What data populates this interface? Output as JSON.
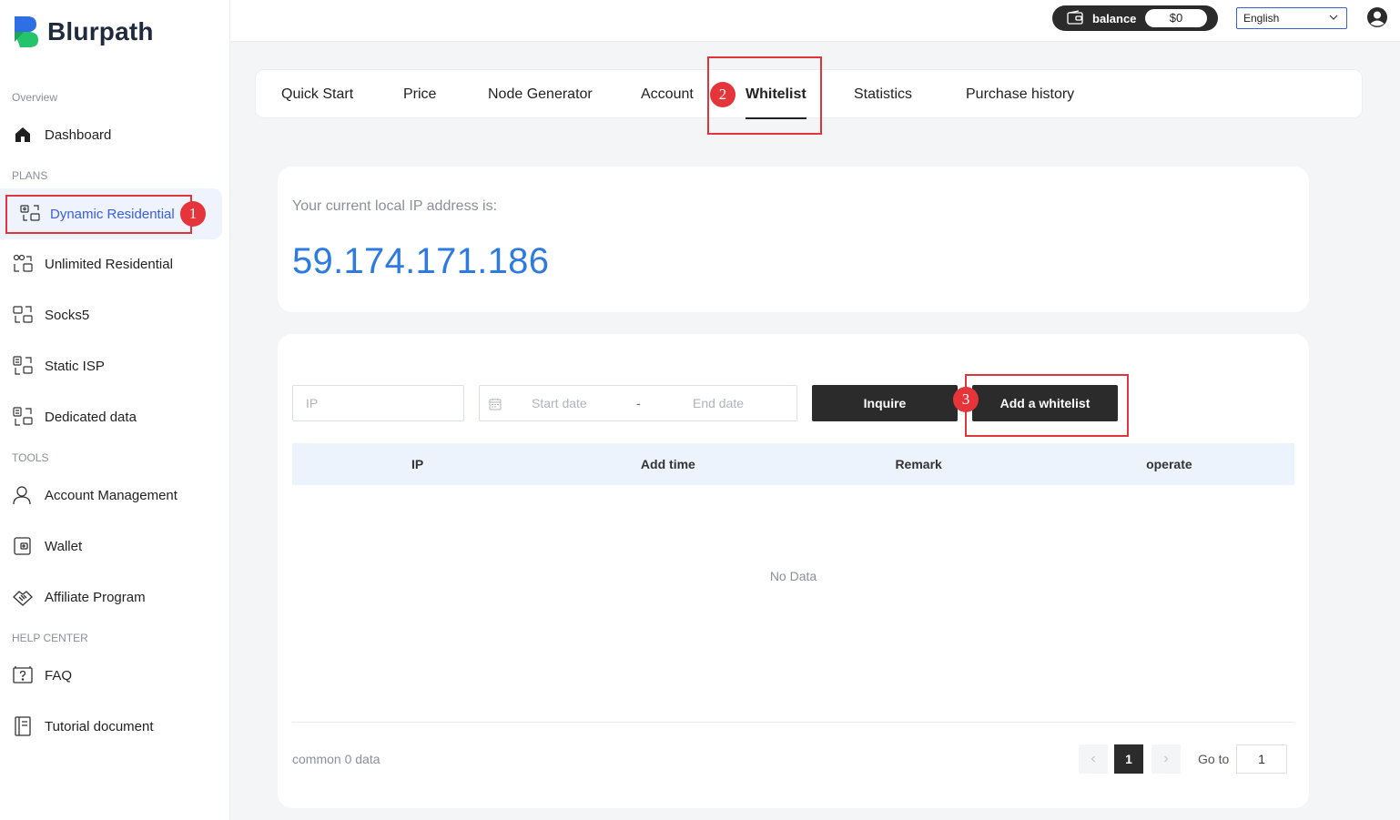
{
  "brand": {
    "name": "Blurpath"
  },
  "sidebar": {
    "sections": {
      "overview": "Overview",
      "plans": "PLANS",
      "tools": "TOOLS",
      "help": "HELP CENTER"
    },
    "items": {
      "dashboard": "Dashboard",
      "dynamic_residential": "Dynamic Residential",
      "unlimited_residential": "Unlimited Residential",
      "socks5": "Socks5",
      "static_isp": "Static ISP",
      "dedicated_data": "Dedicated data",
      "account_management": "Account Management",
      "wallet": "Wallet",
      "affiliate_program": "Affiliate Program",
      "faq": "FAQ",
      "tutorial_document": "Tutorial document"
    }
  },
  "header": {
    "balance_label": "balance",
    "balance_value": "$0",
    "language": "English"
  },
  "tabs": {
    "quick_start": "Quick Start",
    "price": "Price",
    "node_generator": "Node Generator",
    "account": "Account",
    "whitelist": "Whitelist",
    "statistics": "Statistics",
    "purchase_history": "Purchase history"
  },
  "ip_card": {
    "label": "Your current local IP address is:",
    "ip": "59.174.171.186"
  },
  "filters": {
    "ip_placeholder": "IP",
    "start_date_placeholder": "Start date",
    "date_separator": "-",
    "end_date_placeholder": "End date",
    "inquire_label": "Inquire",
    "add_whitelist_label": "Add a whitelist"
  },
  "table": {
    "columns": [
      "IP",
      "Add time",
      "Remark",
      "operate"
    ],
    "empty_text": "No Data"
  },
  "pagination": {
    "total_text": "common 0 data",
    "current_page": "1",
    "goto_label": "Go to",
    "goto_value": "1"
  },
  "annotations": [
    "1",
    "2",
    "3"
  ],
  "colors": {
    "accent_blue": "#3a5fd9",
    "ip_blue": "#2d7be0",
    "dark_button": "#2b2b2b",
    "annotation_red": "#e0353b",
    "table_header": "#edf3fc"
  }
}
